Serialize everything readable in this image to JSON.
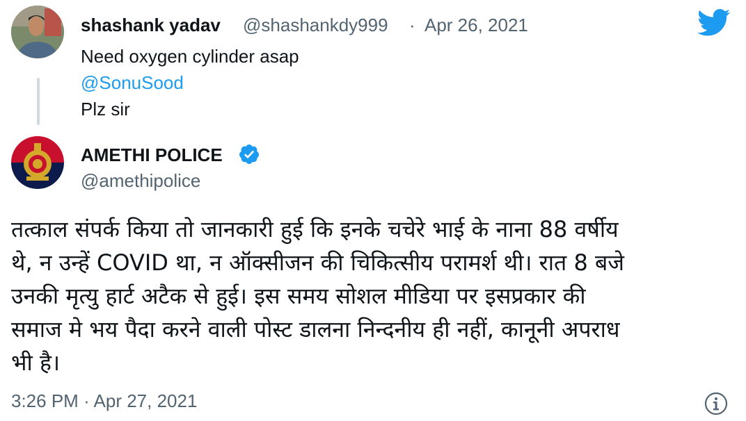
{
  "reply_to": {
    "display_name": "shashank yadav",
    "handle": "@shashankdy999",
    "separator": "·",
    "date": "Apr 26, 2021",
    "lines": [
      "Need oxygen cylinder asap",
      "@SonuSood",
      "Plz sir"
    ]
  },
  "tweet": {
    "display_name": "AMETHI POLICE",
    "handle": "@amethipolice",
    "verified": true,
    "text_lines": [
      "तत्काल संपर्क किया तो जानकारी हुई कि इनके चचेरे भाई के नाना 88 वर्षीय",
      "थे, न उन्हें COVID था, न ऑक्सीजन की चिकित्सीय परामर्श थी। रात 8 बजे",
      "उनकी मृत्यु हार्ट अटैक से हुई। इस समय सोशल मीडिया पर इसप्रकार की",
      "समाज मे भय पैदा करने वाली पोस्ट डालना निन्दनीय ही नहीं, कानूनी अपराध",
      "भी है।"
    ],
    "time": "3:26 PM",
    "separator": "·",
    "date": "Apr 27, 2021"
  },
  "icons": {
    "brand": "twitter-bird-icon",
    "info": "info-icon",
    "verified": "verified-badge-icon"
  },
  "colors": {
    "twitter_blue": "#1d9bf0",
    "text": "#0f1419",
    "muted": "#536471",
    "thread_line": "#cfd9de",
    "police_red": "#c8102e",
    "police_navy": "#0d1b4c",
    "police_gold": "#d4a82a"
  }
}
